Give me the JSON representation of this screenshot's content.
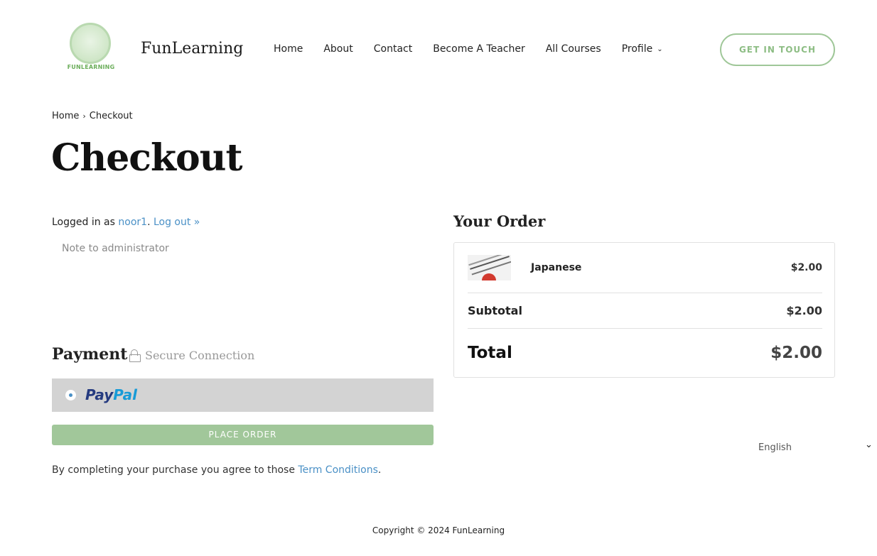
{
  "header": {
    "logo_text": "FUNLEARNING",
    "brand": "FunLearning",
    "nav": [
      {
        "label": "Home"
      },
      {
        "label": "About"
      },
      {
        "label": "Contact"
      },
      {
        "label": "Become A Teacher"
      },
      {
        "label": "All Courses"
      },
      {
        "label": "Profile"
      }
    ],
    "cta_label": "GET IN TOUCH"
  },
  "breadcrumb": {
    "home": "Home",
    "separator": "›",
    "current": "Checkout"
  },
  "page_title": "Checkout",
  "login": {
    "prefix": "Logged in as",
    "username": "noor1",
    "period": ".",
    "logout_label": "Log out »"
  },
  "note": {
    "placeholder": "Note to administrator",
    "value": ""
  },
  "payment": {
    "title": "Payment",
    "secure_label": "Secure Connection",
    "method_pay": "Pay",
    "method_pal": "Pal",
    "place_order_label": "PLACE ORDER",
    "agree_text": "By completing your purchase you agree to those",
    "terms_link": "Term Conditions",
    "agree_end": "."
  },
  "order": {
    "title": "Your Order",
    "items": [
      {
        "name": "Japanese",
        "price": "$2.00",
        "thumb_icon": "course-thumbnail"
      }
    ],
    "subtotal_label": "Subtotal",
    "subtotal_value": "$2.00",
    "total_label": "Total",
    "total_value": "$2.00"
  },
  "language": {
    "selected": "English"
  },
  "footer": {
    "copyright": "Copyright © 2024 FunLearning"
  },
  "colors": {
    "accent_green": "#a1c79a",
    "link_blue": "#4a90c6",
    "paypal_dark": "#253b80",
    "paypal_light": "#179bd7"
  }
}
